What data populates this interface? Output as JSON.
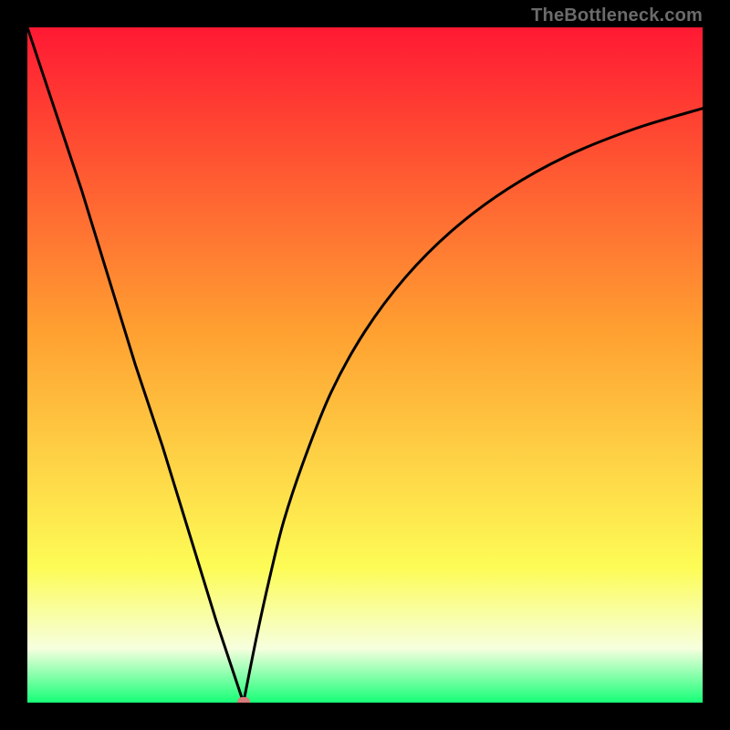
{
  "watermark": "TheBottleneck.com",
  "colors": {
    "frame": "#000000",
    "gradient_top": "#ff1933",
    "gradient_mid1": "#ffa031",
    "gradient_mid2": "#fdfc56",
    "gradient_mid3": "#f6ffde",
    "gradient_bottom": "#16ff77",
    "curve": "#000000",
    "marker": "#d97a7a"
  },
  "chart_data": {
    "type": "line",
    "title": "",
    "xlabel": "",
    "ylabel": "",
    "xlim": [
      0,
      100
    ],
    "ylim": [
      0,
      100
    ],
    "minimum_x": 32,
    "left_branch": {
      "x": [
        0,
        4,
        8,
        12,
        16,
        20,
        24,
        28,
        32
      ],
      "y": [
        100,
        88,
        76,
        63,
        50,
        38,
        25,
        12,
        0
      ]
    },
    "right_branch": {
      "x": [
        32,
        34,
        36,
        38,
        41,
        45,
        50,
        56,
        63,
        71,
        80,
        90,
        100
      ],
      "y": [
        0,
        10,
        19,
        27,
        36,
        46,
        55,
        63,
        70,
        76,
        81,
        85,
        88
      ]
    },
    "marker": {
      "x": 32,
      "y": 0
    },
    "background_gradient_stops": [
      {
        "offset": 0.0,
        "color": "#ff1933"
      },
      {
        "offset": 0.45,
        "color": "#ffa031"
      },
      {
        "offset": 0.8,
        "color": "#fdfc56"
      },
      {
        "offset": 0.92,
        "color": "#f6ffde"
      },
      {
        "offset": 1.0,
        "color": "#16ff77"
      }
    ]
  }
}
